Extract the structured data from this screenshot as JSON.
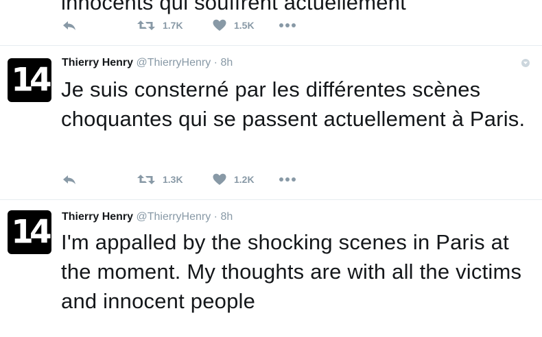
{
  "tweets": [
    {
      "text": "innocents qui souffrent actuellement",
      "retweets": "1.7K",
      "likes": "1.5K"
    },
    {
      "avatar_text": "14",
      "name": "Thierry Henry",
      "handle": "@ThierryHenry",
      "separator": "·",
      "time": "8h",
      "text": "Je suis consterné par les différentes scènes choquantes qui se passent actuellement à Paris.",
      "retweets": "1.3K",
      "likes": "1.2K"
    },
    {
      "avatar_text": "14",
      "name": "Thierry Henry",
      "handle": "@ThierryHenry",
      "separator": "·",
      "time": "8h",
      "text": "I'm appalled by the shocking scenes in Paris at the moment. My thoughts are with all the victims and innocent people"
    }
  ],
  "icons": {
    "reply": "reply-icon",
    "retweet": "retweet-icon",
    "like": "heart-icon",
    "more": "more-icon",
    "caret": "chevron-down-icon"
  },
  "colors": {
    "text": "#14171a",
    "muted": "#8899a6",
    "divider": "#e6ecf0",
    "avatar_bg": "#000000"
  }
}
